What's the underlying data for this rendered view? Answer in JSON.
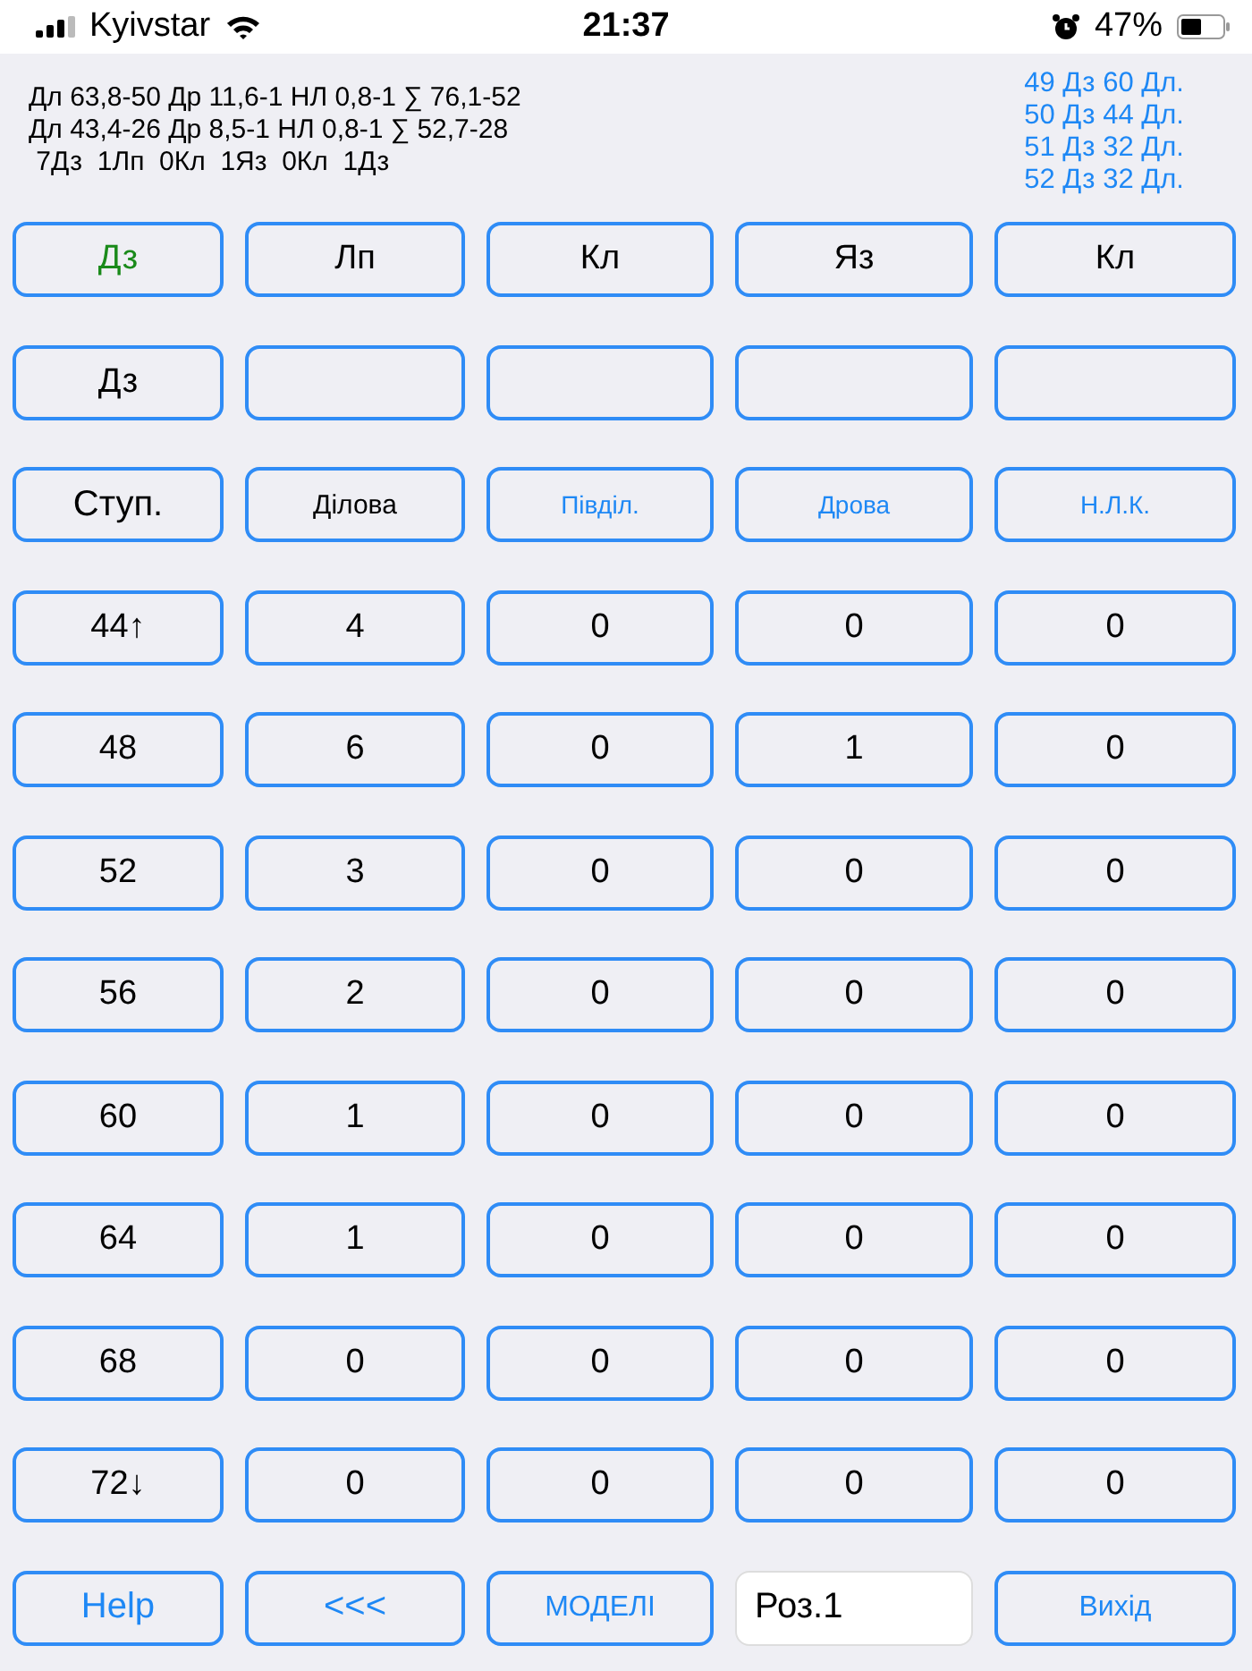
{
  "status_bar": {
    "carrier": "Kyivstar",
    "time": "21:37",
    "battery": "47%"
  },
  "summary": {
    "lines": [
      "Дл 63,8-50 Др 11,6-1 НЛ 0,8-1 ∑ 76,1-52",
      "Дл 43,4-26 Др 8,5-1 НЛ 0,8-1 ∑ 52,7-28",
      " 7Дз  1Лп  0Кл  1Яз  0Кл  1Дз"
    ],
    "links": [
      "49 Дз 60 Дл.",
      "50 Дз 44 Дл.",
      "51 Дз 32 Дл.",
      "52 Дз 32 Дл."
    ]
  },
  "species": [
    {
      "label": "Дз",
      "selected": true
    },
    {
      "label": "Лп",
      "selected": false
    },
    {
      "label": "Кл",
      "selected": false
    },
    {
      "label": "Яз",
      "selected": false
    },
    {
      "label": "Кл",
      "selected": false
    }
  ],
  "second_row": [
    {
      "kind": "label",
      "label": "Дз"
    },
    {
      "kind": "blank"
    },
    {
      "kind": "blank"
    },
    {
      "kind": "blank"
    },
    {
      "kind": "blank"
    }
  ],
  "categories": [
    {
      "label": "Ступ.",
      "kind": "header"
    },
    {
      "label": "Ділова",
      "kind": "plain"
    },
    {
      "label": "Півділ.",
      "kind": "link"
    },
    {
      "label": "Дрова",
      "kind": "link"
    },
    {
      "label": "Н.Л.К.",
      "kind": "link"
    }
  ],
  "rows": [
    [
      "44↑",
      "4",
      "0",
      "0",
      "0"
    ],
    [
      "48",
      "6",
      "0",
      "1",
      "0"
    ],
    [
      "52",
      "3",
      "0",
      "0",
      "0"
    ],
    [
      "56",
      "2",
      "0",
      "0",
      "0"
    ],
    [
      "60",
      "1",
      "0",
      "0",
      "0"
    ],
    [
      "64",
      "1",
      "0",
      "0",
      "0"
    ],
    [
      "68",
      "0",
      "0",
      "0",
      "0"
    ],
    [
      "72↓",
      "0",
      "0",
      "0",
      "0"
    ]
  ],
  "footer": {
    "help": "Help",
    "back": "<<<",
    "models": "МОДЕЛІ",
    "field_value": "Роз.1",
    "exit": "Вихід"
  }
}
